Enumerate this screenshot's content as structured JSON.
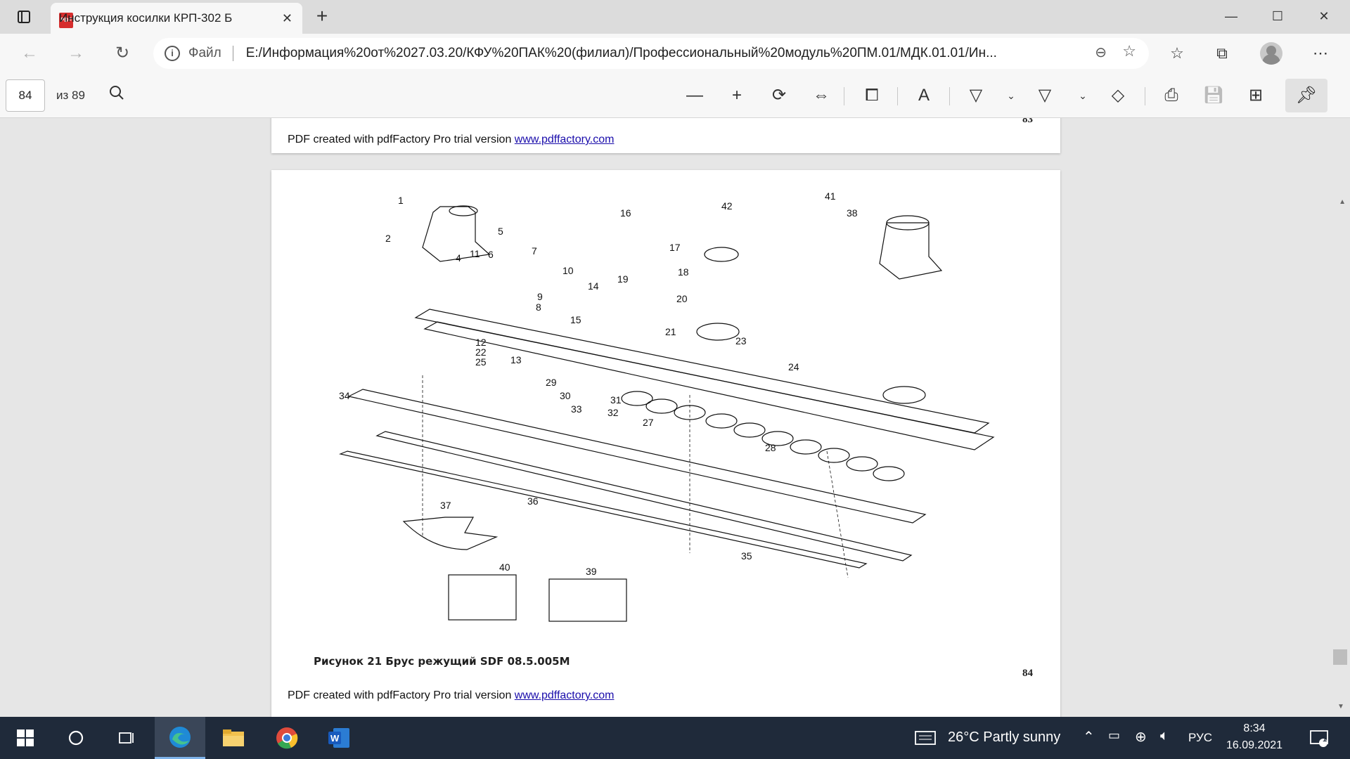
{
  "browser": {
    "tab_title": "Инструкция косилки КРП-302 Б",
    "file_label": "Файл",
    "url": "E:/Информация%20от%2027.03.20/КФУ%20ПАК%20(филиал)/Профессиональный%20модуль%20ПМ.01/МДК.01.01/Ин..."
  },
  "pdf_toolbar": {
    "page_current": "84",
    "page_total": "из 89"
  },
  "document": {
    "prev_page_number": "83",
    "pdf_note_text": "PDF created with pdfFactory Pro trial version ",
    "pdf_note_link": "www.pdffactory.com",
    "figure_caption": "Рисунок 21 Брус режущий SDF 08.5.005M",
    "page_number": "84",
    "callouts": [
      "1",
      "2",
      "4",
      "5",
      "6",
      "7",
      "10",
      "11",
      "9",
      "8",
      "12",
      "22",
      "25",
      "13",
      "14",
      "15",
      "16",
      "17",
      "18",
      "19",
      "20",
      "21",
      "42",
      "41",
      "38",
      "23",
      "24",
      "29",
      "30",
      "31",
      "32",
      "33",
      "34",
      "27",
      "28",
      "37",
      "36",
      "35",
      "39",
      "40"
    ]
  },
  "taskbar": {
    "weather": "26°C  Partly sunny",
    "language": "РУС",
    "time": "8:34",
    "date": "16.09.2021",
    "notifications": "1"
  },
  "icons": {
    "tab_favicon": "pdf-icon",
    "search": "search-icon",
    "browser": "edge-icon",
    "explorer": "folder-icon",
    "chrome": "chrome-icon",
    "word": "word-icon"
  }
}
